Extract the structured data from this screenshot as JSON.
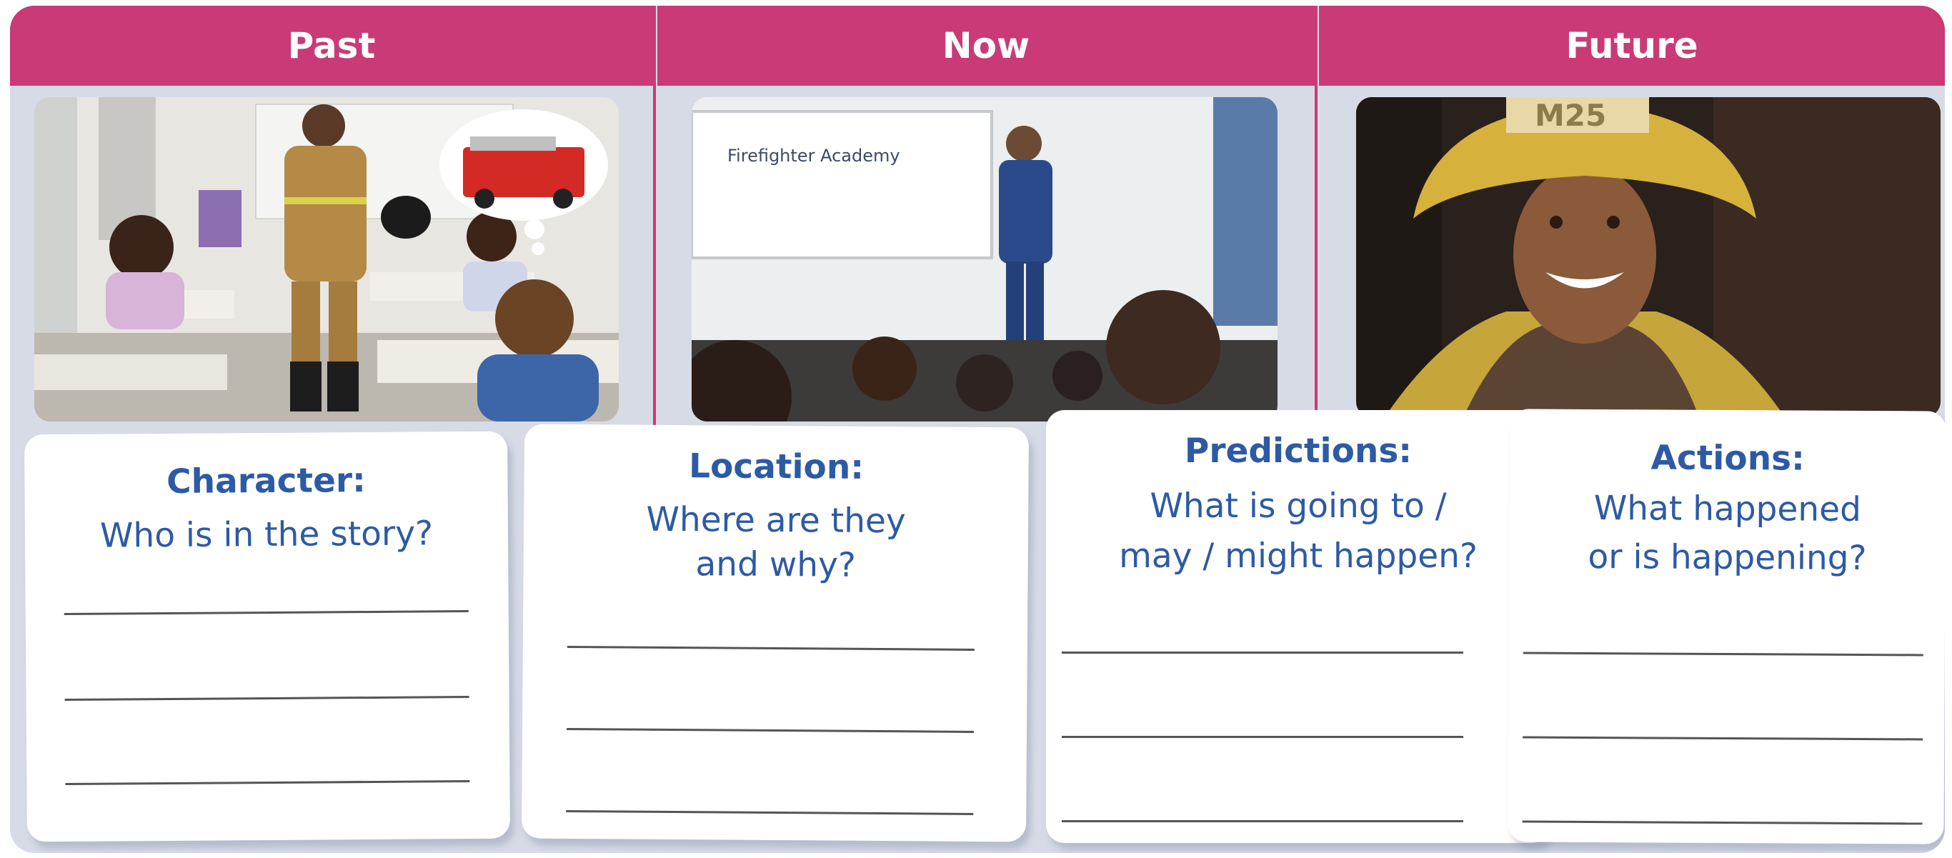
{
  "columns": [
    {
      "header": "Past"
    },
    {
      "header": "Now"
    },
    {
      "header": "Future"
    }
  ],
  "photos": {
    "now": {
      "whiteboard_text": "Firefighter Academy"
    },
    "future": {
      "helmet_text": "M25"
    }
  },
  "cards": [
    {
      "label": "Character:",
      "question": "Who is in the story?"
    },
    {
      "label": "Location:",
      "question": "Where are they and why?",
      "question_lines": [
        "Where are they",
        "and why?"
      ]
    },
    {
      "label": "Predictions:",
      "question": "What is going to / may / might happen?",
      "question_lines": [
        "What is going to /",
        "may / might happen?"
      ]
    },
    {
      "label": "Actions:",
      "question": "What happened or is happening?",
      "question_lines": [
        "What happened",
        "or is happening?"
      ]
    }
  ],
  "colors": {
    "header": "#c93a76",
    "board": "#d7dbe6",
    "text": "#2d5aa5"
  }
}
